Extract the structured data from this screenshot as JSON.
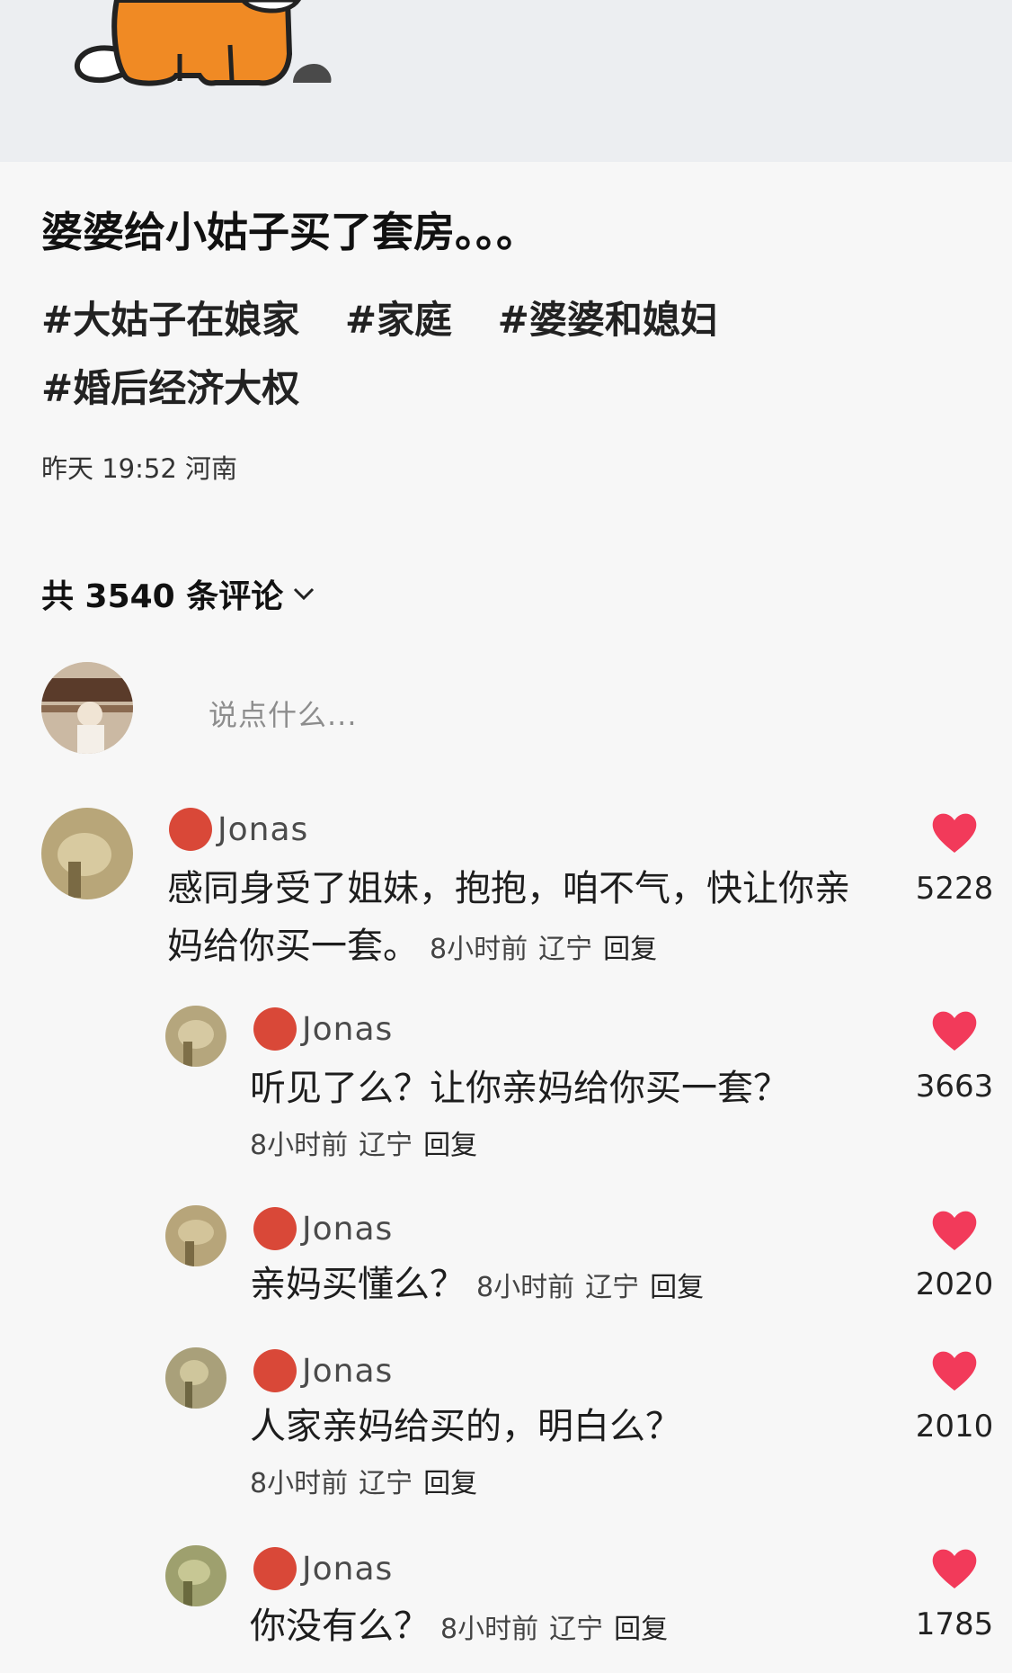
{
  "post": {
    "title": "婆婆给小姑子买了套房。。。",
    "tags": [
      "#大姑子在娘家",
      "#家庭",
      "#婆婆和媳妇",
      "#婚后经济大权"
    ],
    "time": "昨天 19:52",
    "location": "河南"
  },
  "comments_header": {
    "label": "共 3540 条评论",
    "input_placeholder": "说点什么..."
  },
  "comments": [
    {
      "user": "Jonas",
      "text": "感同身受了姐妹，抱抱，咱不气，快让你亲妈给你买一套。",
      "time": "8小时前",
      "location": "辽宁",
      "reply": "回复",
      "likes": "5228"
    },
    {
      "user": "Jonas",
      "text": "听见了么？让你亲妈给你买一套？",
      "time": "8小时前",
      "location": "辽宁",
      "reply": "回复",
      "likes": "3663"
    },
    {
      "user": "Jonas",
      "text": "亲妈买懂么？",
      "time": "8小时前",
      "location": "辽宁",
      "reply": "回复",
      "likes": "2020"
    },
    {
      "user": "Jonas",
      "text": "人家亲妈给买的，明白么？",
      "time": "8小时前",
      "location": "辽宁",
      "reply": "回复",
      "likes": "2010"
    },
    {
      "user": "Jonas",
      "text": "你没有么？",
      "time": "8小时前",
      "location": "辽宁",
      "reply": "回复",
      "likes": "1785"
    }
  ],
  "icons": {
    "heart": "heart-icon",
    "chevron": "chevron-down-icon"
  },
  "colors": {
    "heart": "#f23a5a",
    "banner": "#eceef1",
    "cat": "#f08a24"
  }
}
